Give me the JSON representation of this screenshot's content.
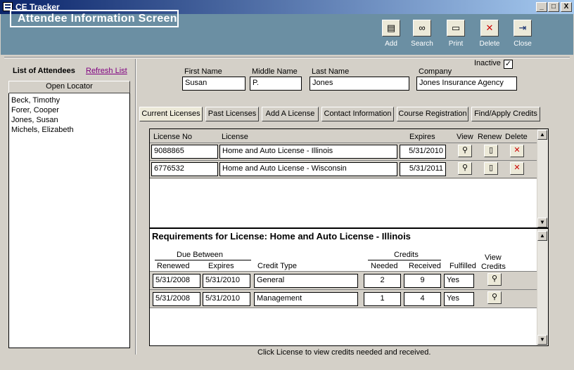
{
  "window": {
    "title": "CE Tracker",
    "controls": [
      "_",
      "□",
      "X"
    ]
  },
  "header": {
    "screen_title": "Attendee Information Screen"
  },
  "toolbar": [
    {
      "label": "Add",
      "icon": "add-icon"
    },
    {
      "label": "Search",
      "icon": "binoculars-icon"
    },
    {
      "label": "Print",
      "icon": "printer-icon"
    },
    {
      "label": "Delete",
      "icon": "delete-icon"
    },
    {
      "label": "Close",
      "icon": "door-exit-icon"
    }
  ],
  "sidebar": {
    "heading": "List of Attendees",
    "refresh_label": "Refresh List",
    "locator_label": "Open Locator",
    "attendees": [
      "Beck, Timothy",
      "Forer, Cooper",
      "Jones, Susan",
      "Michels, Elizabeth"
    ]
  },
  "attendee": {
    "first_name_label": "First Name",
    "first_name": "Susan",
    "middle_name_label": "Middle Name",
    "middle_name": "P.",
    "last_name_label": "Last Name",
    "last_name": "Jones",
    "company_label": "Company",
    "company": "Jones Insurance Agency",
    "inactive_label": "Inactive",
    "inactive_checked": "✓"
  },
  "tabs": [
    "Current Licenses",
    "Past Licenses",
    "Add A License",
    "Contact Information",
    "Course Registration",
    "Find/Apply Credits"
  ],
  "licenses": {
    "headers": {
      "license_no": "License No",
      "license": "License",
      "expires": "Expires",
      "view": "View",
      "renew": "Renew",
      "delete": "Delete"
    },
    "rows": [
      {
        "license_no": "9088865",
        "license": "Home and Auto License - Illinois",
        "expires": "5/31/2010"
      },
      {
        "license_no": "6776532",
        "license": "Home and Auto License - Wisconsin",
        "expires": "5/31/2011"
      }
    ]
  },
  "requirements": {
    "title": "Requirements for License: Home and Auto License - Illinois",
    "group_due": "Due Between",
    "group_credits": "Credits",
    "headers": {
      "renewed": "Renewed",
      "expires": "Expires",
      "credit_type": "Credit Type",
      "needed": "Needed",
      "received": "Received",
      "fulfilled": "Fulfilled",
      "view_credits_1": "View",
      "view_credits_2": "Credits"
    },
    "rows": [
      {
        "renewed": "5/31/2008",
        "expires": "5/31/2010",
        "credit_type": "General",
        "needed": "2",
        "received": "9",
        "fulfilled": "Yes"
      },
      {
        "renewed": "5/31/2008",
        "expires": "5/31/2010",
        "credit_type": "Management",
        "needed": "1",
        "received": "4",
        "fulfilled": "Yes"
      }
    ]
  },
  "footer_note": "Click License to view credits needed and received."
}
